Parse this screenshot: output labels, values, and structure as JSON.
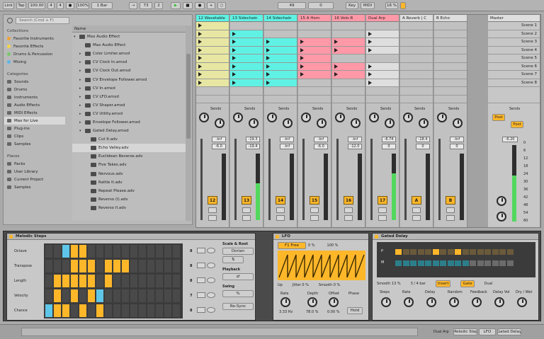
{
  "topbar": {
    "link": "Link",
    "tap": "Tap",
    "bpm": "100.00",
    "sig_num": "4",
    "sig_den": "4",
    "zoom": "100%",
    "quant": "1 Bar",
    "bar": "73",
    "beat": "2",
    "loop_start": "49",
    "loop_len": "0",
    "key": "Key",
    "midi": "MIDI",
    "cpu": "16 %"
  },
  "browser": {
    "search_placeholder": "Search (Cmd + F)",
    "collections_label": "Collections",
    "collections": [
      {
        "label": "Favorite Instruments",
        "color": "#f2a335"
      },
      {
        "label": "Favorite Effects",
        "color": "#f6d54a"
      },
      {
        "label": "Drums & Percussion",
        "color": "#79c96a"
      },
      {
        "label": "Mixing",
        "color": "#5eb6e8"
      }
    ],
    "categories_label": "Categories",
    "categories": [
      "Sounds",
      "Drums",
      "Instruments",
      "Audio Effects",
      "MIDI Effects",
      "Max for Live",
      "Plug-ins",
      "Clips",
      "Samples"
    ],
    "selected_category": "Max for Live",
    "places_label": "Places",
    "places": [
      "Packs",
      "User Library",
      "Current Project",
      "Samples"
    ],
    "name_header": "Name",
    "files": [
      {
        "label": "Max Audio Effect",
        "arrow": "▾",
        "indent": 0
      },
      {
        "label": "Max Audio Effect",
        "arrow": "",
        "indent": 1
      },
      {
        "label": "Color Limiter.amxd",
        "arrow": "▸",
        "indent": 1
      },
      {
        "label": "CV Clock In.amxd",
        "arrow": "▸",
        "indent": 1
      },
      {
        "label": "CV Clock Out.amxd",
        "arrow": "▸",
        "indent": 1
      },
      {
        "label": "CV Envelope Follower.amxd",
        "arrow": "▸",
        "indent": 1
      },
      {
        "label": "CV In.amxd",
        "arrow": "▸",
        "indent": 1
      },
      {
        "label": "CV LFO.amxd",
        "arrow": "▸",
        "indent": 1
      },
      {
        "label": "CV Shaper.amxd",
        "arrow": "▸",
        "indent": 1
      },
      {
        "label": "CV Utility.amxd",
        "arrow": "▸",
        "indent": 1
      },
      {
        "label": "Envelope Follower.amxd",
        "arrow": "▸",
        "indent": 1
      },
      {
        "label": "Gated Delay.amxd",
        "arrow": "▾",
        "indent": 1
      },
      {
        "label": "Cut It.adv",
        "arrow": "",
        "indent": 2
      },
      {
        "label": "Echo Valley.adv",
        "arrow": "",
        "indent": 2
      },
      {
        "label": "Euclidean Reverse.adv",
        "arrow": "",
        "indent": 2
      },
      {
        "label": "Five Takes.adv",
        "arrow": "",
        "indent": 2
      },
      {
        "label": "Nervous.adv",
        "arrow": "",
        "indent": 2
      },
      {
        "label": "Rattle It.adv",
        "arrow": "",
        "indent": 2
      },
      {
        "label": "Repeat Please.adv",
        "arrow": "",
        "indent": 2
      },
      {
        "label": "Reverso (I).adv",
        "arrow": "",
        "indent": 2
      },
      {
        "label": "Reverso II.adv",
        "arrow": "",
        "indent": 2
      }
    ],
    "selected_file": "Echo Valley.adv"
  },
  "tracks": [
    {
      "name": "12 Wavetable",
      "color": "#5ff2e4",
      "num": "12",
      "vol": "-Inf",
      "pan": "-6.0",
      "level": 0.0
    },
    {
      "name": "13 Sidechain",
      "color": "#5ff2e4",
      "num": "13",
      "vol": "-19.3",
      "pan": "-19.4",
      "level": 0.55
    },
    {
      "name": "14 Sidechain",
      "color": "#5ff2e4",
      "num": "14",
      "vol": "-Inf",
      "pan": "-Inf",
      "level": 0.0
    },
    {
      "name": "15 A Horn",
      "color": "#ff99a8",
      "num": "15",
      "vol": "-Inf",
      "pan": "-6.0",
      "level": 0.0
    },
    {
      "name": "16 Velo-R",
      "color": "#ff99a8",
      "num": "16",
      "vol": "-Inf",
      "pan": "-12.0",
      "level": 0.0
    },
    {
      "name": "Dual Arp",
      "color": "#ff99a8",
      "num": "17",
      "vol": "-6.74",
      "pan": "0",
      "level": 0.7
    },
    {
      "name": "A Reverb | C",
      "color": "#dedede",
      "num": "A",
      "vol": "-18.4",
      "pan": "0",
      "level": 0.0
    },
    {
      "name": "B Echo",
      "color": "#dedede",
      "num": "B",
      "vol": "-Inf",
      "pan": "0",
      "level": 0.0
    }
  ],
  "master": {
    "name": "Master",
    "vol": "-6.20",
    "scenes": [
      "Scene 1",
      "Scene 2",
      "Scene 3",
      "Scene 4",
      "Scene 5",
      "Scene 6",
      "Scene 7",
      "Scene 8"
    ],
    "meter_ticks": [
      "0",
      "6",
      "12",
      "18",
      "24",
      "30",
      "36",
      "42",
      "48",
      "54",
      "60"
    ]
  },
  "sends_label": "Sends",
  "post_label": "Post",
  "devices": {
    "melodic": {
      "title": "Melodic Steps",
      "rows": [
        "Octave",
        "Transpose",
        "Length",
        "Velocity",
        "Chance"
      ],
      "scale_label": "Scale & Root",
      "scale": "Dorian",
      "playback_label": "Playback",
      "swing_label": "Swing",
      "sync_label": "Re-Sync",
      "values": [
        "8",
        "8",
        "8",
        "7",
        "8"
      ]
    },
    "lfo": {
      "title": "LFO",
      "mode": "F1 Free",
      "depth": "0 %",
      "amt": "100 %",
      "up": "Up",
      "jitter": "Jitter 0 %",
      "smooth": "Smooth 0 %",
      "rate_label": "Rate",
      "rate": "3.33 Hz",
      "depth_label": "Depth",
      "depth_val": "78.0 %",
      "offset_label": "Offset",
      "offset": "0.00 %",
      "phase_label": "Phase",
      "hold": "Hold"
    },
    "gated": {
      "title": "Gated Delay",
      "p": "P",
      "m": "M",
      "smooth": "Smooth 13 %",
      "time": "3 / 4 bar",
      "insert": "Insert",
      "gate": "Gate",
      "dual": "Dual",
      "knobs": [
        "Steps",
        "Rate",
        "Delay",
        "Random",
        "Feedback",
        "Delay Vol",
        "Dry / Wet"
      ]
    }
  },
  "status": {
    "track": "Dual Arp",
    "melodic": "Melodic Step",
    "lfo": "LFO",
    "gated": "Gated Delay"
  }
}
